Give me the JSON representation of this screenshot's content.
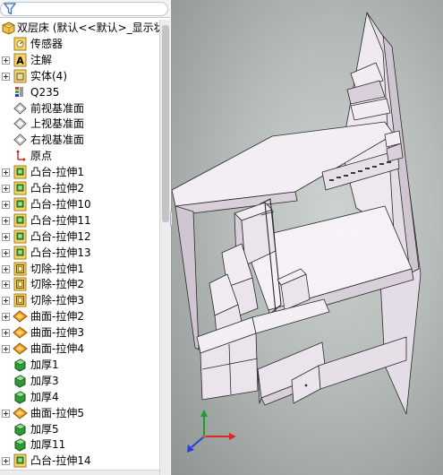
{
  "feature_tree": {
    "filter_placeholder": "",
    "root": {
      "label": "双层床  (默认<<默认>_显示状",
      "icon": "part-icon"
    },
    "items": [
      {
        "label": "传感器",
        "icon": "sensor-icon",
        "expandable": false
      },
      {
        "label": "注解",
        "icon": "annotation-icon",
        "expandable": true
      },
      {
        "label": "实体(4)",
        "icon": "solid-bodies-icon",
        "expandable": true
      },
      {
        "label": "Q235",
        "icon": "material-icon",
        "expandable": false
      },
      {
        "label": "前视基准面",
        "icon": "plane-icon",
        "expandable": false
      },
      {
        "label": "上视基准面",
        "icon": "plane-icon",
        "expandable": false
      },
      {
        "label": "右视基准面",
        "icon": "plane-icon",
        "expandable": false
      },
      {
        "label": "原点",
        "icon": "origin-icon",
        "expandable": false
      },
      {
        "label": "凸台-拉伸1",
        "icon": "boss-extrude-icon",
        "expandable": true
      },
      {
        "label": "凸台-拉伸2",
        "icon": "boss-extrude-icon",
        "expandable": true
      },
      {
        "label": "凸台-拉伸10",
        "icon": "boss-extrude-icon",
        "expandable": true
      },
      {
        "label": "凸台-拉伸11",
        "icon": "boss-extrude-icon",
        "expandable": true
      },
      {
        "label": "凸台-拉伸12",
        "icon": "boss-extrude-icon",
        "expandable": true
      },
      {
        "label": "凸台-拉伸13",
        "icon": "boss-extrude-icon",
        "expandable": true
      },
      {
        "label": "切除-拉伸1",
        "icon": "cut-extrude-icon",
        "expandable": true
      },
      {
        "label": "切除-拉伸2",
        "icon": "cut-extrude-icon",
        "expandable": true
      },
      {
        "label": "切除-拉伸3",
        "icon": "cut-extrude-icon",
        "expandable": true
      },
      {
        "label": "曲面-拉伸2",
        "icon": "surface-extrude-icon",
        "expandable": true
      },
      {
        "label": "曲面-拉伸3",
        "icon": "surface-extrude-icon",
        "expandable": true
      },
      {
        "label": "曲面-拉伸4",
        "icon": "surface-extrude-icon",
        "expandable": true
      },
      {
        "label": "加厚1",
        "icon": "thicken-icon",
        "expandable": false
      },
      {
        "label": "加厚3",
        "icon": "thicken-icon",
        "expandable": false
      },
      {
        "label": "加厚4",
        "icon": "thicken-icon",
        "expandable": false
      },
      {
        "label": "曲面-拉伸5",
        "icon": "surface-extrude-icon",
        "expandable": true
      },
      {
        "label": "加厚5",
        "icon": "thicken-icon",
        "expandable": false
      },
      {
        "label": "加厚11",
        "icon": "thicken-icon",
        "expandable": false
      },
      {
        "label": "凸台-拉伸14",
        "icon": "boss-extrude-icon",
        "expandable": true
      }
    ]
  },
  "viewport": {
    "watermark": "id28",
    "triad_axes": [
      "x-axis",
      "y-axis",
      "z-axis"
    ],
    "colors": {
      "model_face": "#ede6ee",
      "model_edge": "#2a2a2a",
      "axis_x": "#e0242a",
      "axis_y": "#1f9c2a",
      "axis_z": "#2b3cd8"
    }
  }
}
